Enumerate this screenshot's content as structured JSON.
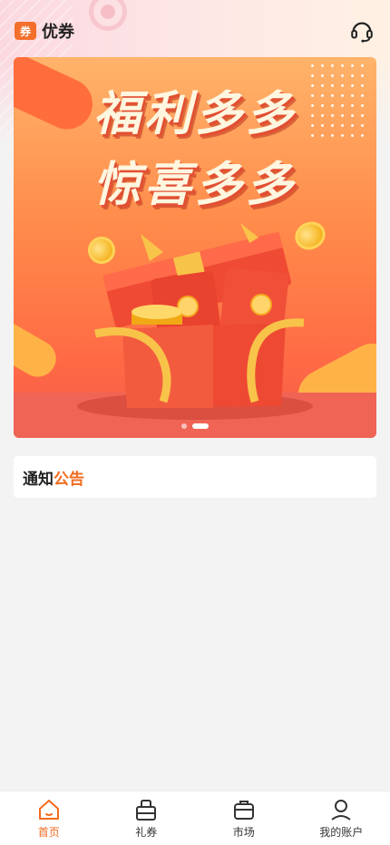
{
  "header": {
    "logo_text": "券",
    "app_name": "优券",
    "support_icon": "headset-icon"
  },
  "banner": {
    "line1": "福利多多",
    "line2": "惊喜多多",
    "slides": 2,
    "active_slide": 2
  },
  "notice": {
    "label_part1": "通知",
    "label_part2": "公告"
  },
  "tabbar": {
    "items": [
      {
        "label": "首页",
        "icon": "home-icon",
        "active": true
      },
      {
        "label": "礼券",
        "icon": "gift-bag-icon",
        "active": false
      },
      {
        "label": "市场",
        "icon": "market-box-icon",
        "active": false
      },
      {
        "label": "我的账户",
        "icon": "user-icon",
        "active": false
      }
    ]
  },
  "colors": {
    "accent": "#f36a1d",
    "banner_top": "#ffb36a",
    "banner_bottom": "#f35a4a"
  }
}
